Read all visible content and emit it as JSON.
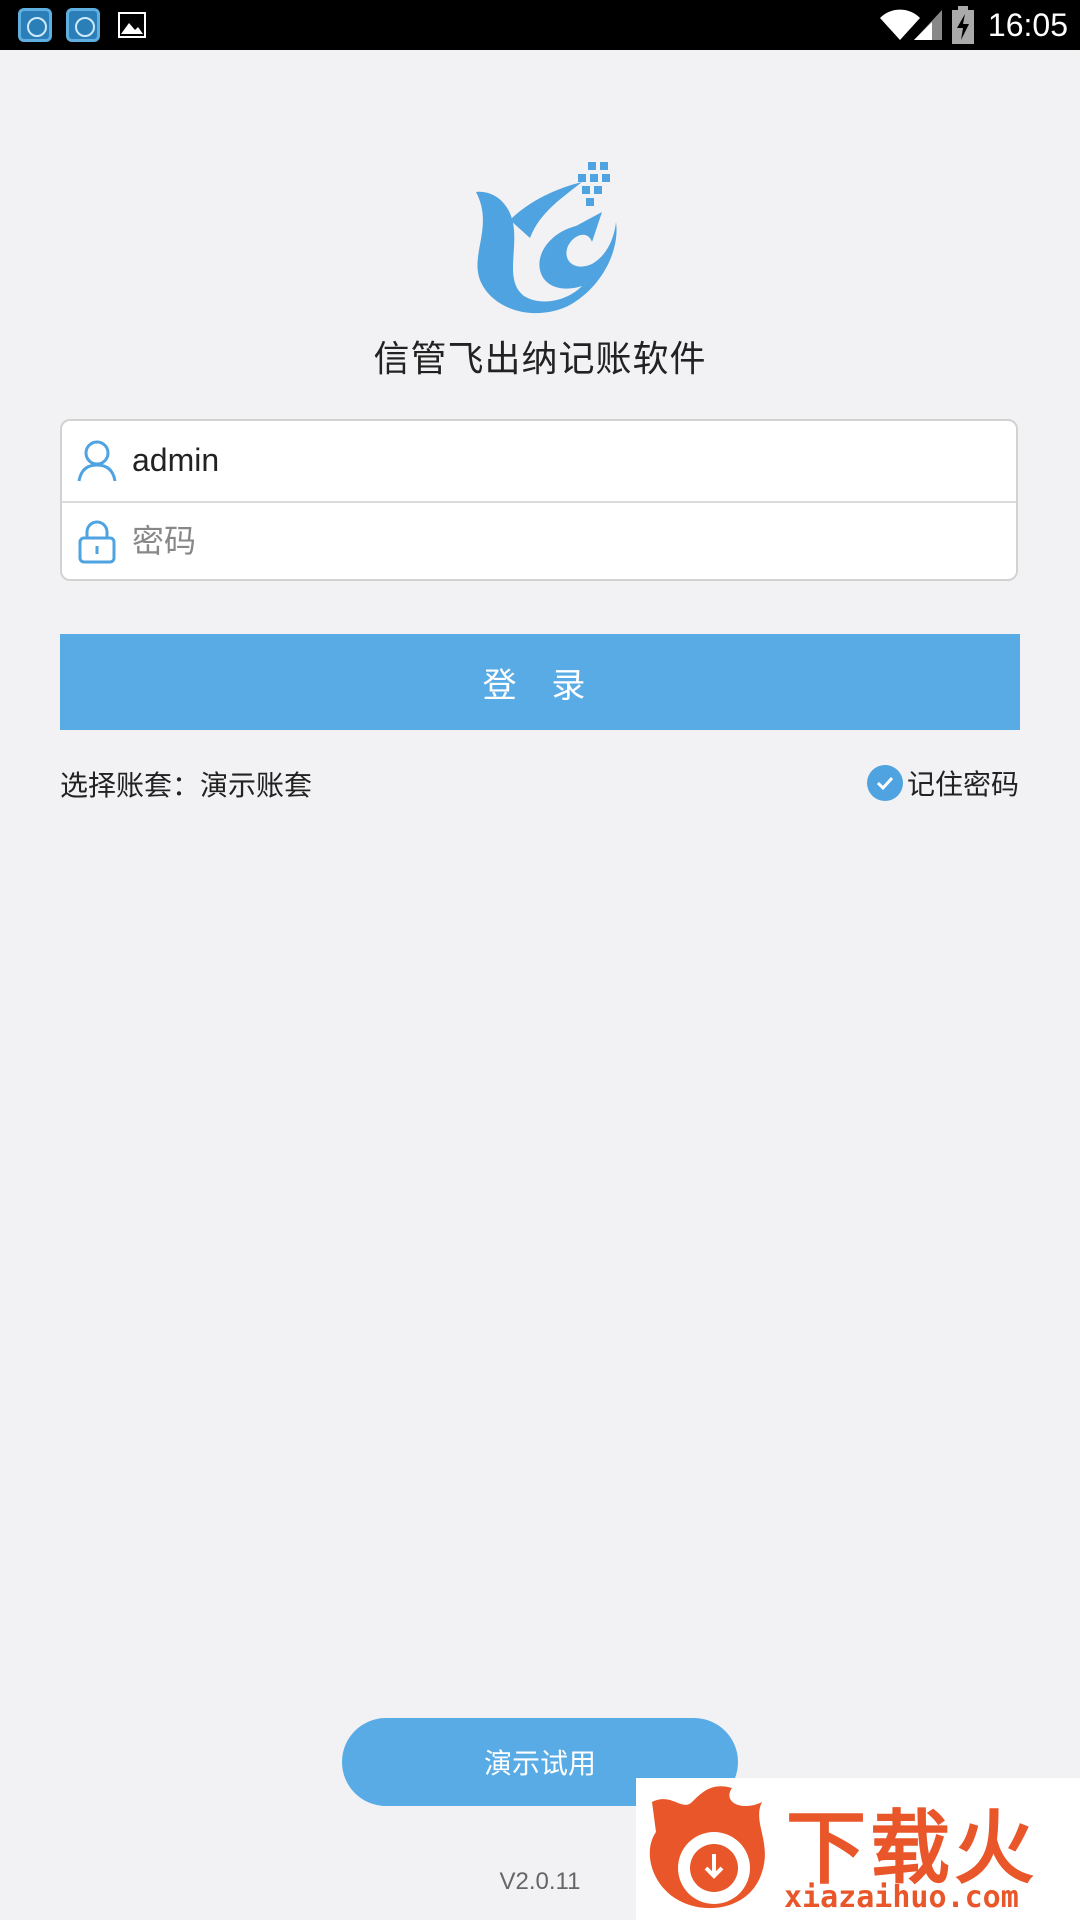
{
  "status_bar": {
    "time": "16:05",
    "left_icons": [
      "nox-app-icon",
      "nox-app-icon",
      "image-icon"
    ],
    "right_icons": [
      "wifi-icon",
      "signal-icon",
      "battery-charging-icon"
    ]
  },
  "app": {
    "title": "信管飞出纳记账软件",
    "brand_color": "#58abe5"
  },
  "login_form": {
    "username_value": "admin",
    "password_placeholder": "密码",
    "login_label": "登 录"
  },
  "options": {
    "account_set_text": "选择账套：演示账套",
    "remember_label": "记住密码",
    "remember_checked": true
  },
  "demo_button_label": "演示试用",
  "version": "V2.0.11",
  "watermark": {
    "brand": "下载火",
    "url": "xiazaihuo.com"
  }
}
